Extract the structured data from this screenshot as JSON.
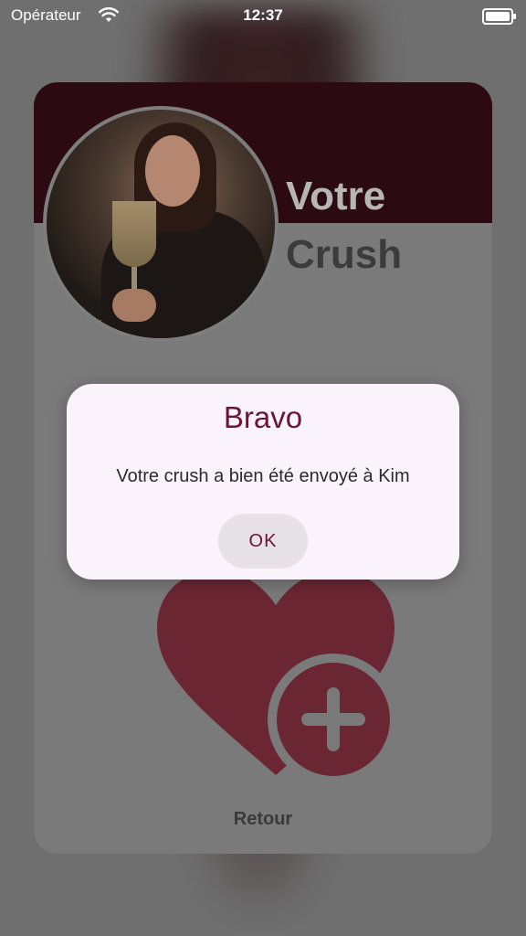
{
  "status_bar": {
    "carrier": "Opérateur",
    "time": "12:37"
  },
  "card": {
    "title_line1": "Votre",
    "title_line2": "Crush",
    "back_label": "Retour",
    "accent_color": "#2c0a12",
    "heart_color": "#6b2633"
  },
  "dialog": {
    "title": "Bravo",
    "message": "Votre crush a bien été envoyé à Kim",
    "ok_label": "OK"
  },
  "icons": {
    "wifi": "wifi-icon",
    "battery": "battery-icon",
    "heart_add": "heart-plus-icon"
  }
}
